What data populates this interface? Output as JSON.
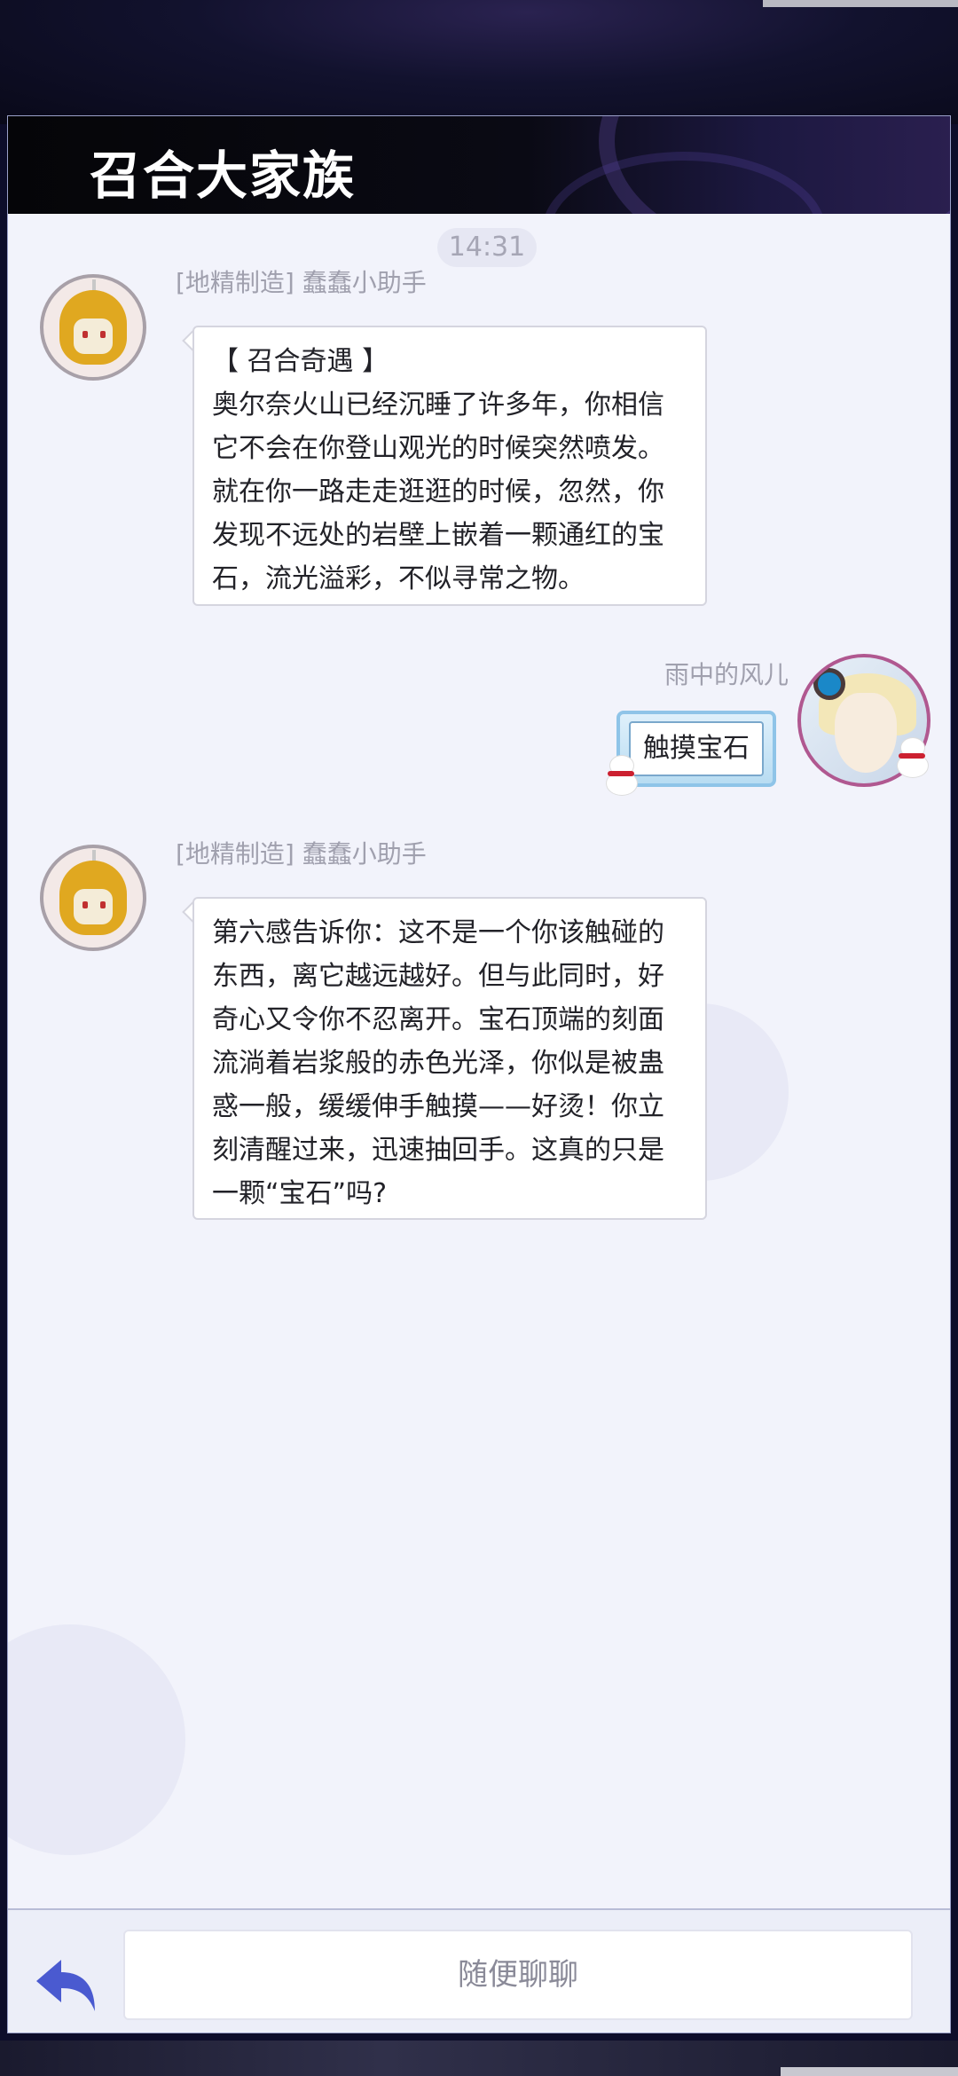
{
  "header": {
    "title": "召合大家族"
  },
  "chat": {
    "time": "14:31",
    "messages": [
      {
        "sender": "[地精制造] 蠢蠢小助手",
        "lines": [
          "【 召合奇遇 】",
          "奥尔奈火山已经沉睡了许多年，你相信",
          "它不会在你登山观光的时候突然喷发。",
          "就在你一路走走逛逛的时候，忽然，你",
          "发现不远处的岩壁上嵌着一颗通红的宝",
          "石，流光溢彩，不似寻常之物。"
        ]
      },
      {
        "sender": "雨中的风儿",
        "text": "触摸宝石"
      },
      {
        "sender": "[地精制造] 蠢蠢小助手",
        "lines": [
          "第六感告诉你：这不是一个你该触碰的",
          "东西，离它越远越好。但与此同时，好",
          "奇心又令你不忍离开。宝石顶端的刻面",
          "流淌着岩浆般的赤色光泽，你似是被蛊",
          "惑一般，缓缓伸手触摸——好烫！你立",
          "刻清醒过来，迅速抽回手。这真的只是",
          "一颗“宝石”吗?"
        ]
      }
    ]
  },
  "input_bar": {
    "placeholder": "随便聊聊",
    "back_icon": "back-arrow-icon"
  },
  "colors": {
    "accent": "#4a5ad0",
    "panel_bg": "#f2f3fb",
    "header_bg": "#050508"
  }
}
